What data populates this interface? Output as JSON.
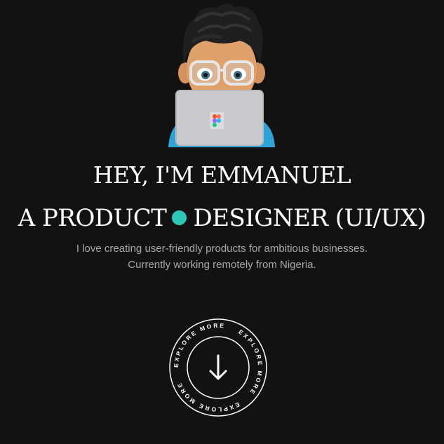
{
  "avatar": {
    "icon": "memoji-developer-laptop-icon",
    "laptop_logo": "figma-logo-icon"
  },
  "hero": {
    "greeting": "HEY, I'M EMMANUEL",
    "role_part1": "A PRODUCT",
    "role_part2": "DESIGNER (UI/UX)",
    "separator_color": "#2cc7b8",
    "intro_line1": "I love creating user-friendly products for ambitious businesses.",
    "intro_line2": "Currently working remotely from Nigeria."
  },
  "explore": {
    "ring_text": "EXPLORE MORE",
    "icon": "arrow-down-icon"
  },
  "colors": {
    "background": "#121212",
    "text": "#ffffff",
    "muted_text": "#a9a9a9"
  }
}
